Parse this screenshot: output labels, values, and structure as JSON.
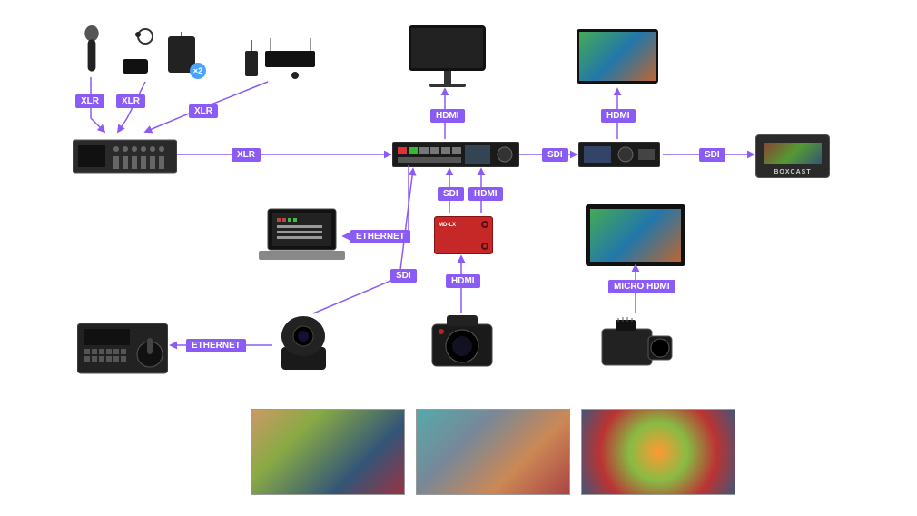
{
  "labels": {
    "xlr1": "XLR",
    "xlr2": "XLR",
    "xlr3": "XLR",
    "xlr4": "XLR",
    "hdmi1": "HDMI",
    "hdmi2": "HDMI",
    "hdmi3": "HDMI",
    "sdi1": "SDI",
    "sdi2": "SDI",
    "sdi3": "SDI",
    "sdi4": "SDI",
    "eth1": "ETHERNET",
    "eth2": "ETHERNET",
    "microhdmi": "MICRO HDMI"
  },
  "badge_x2": "×2",
  "brand_boxcast": "BOXCAST",
  "nodes": {
    "mic": "handheld-microphone",
    "lav": "lavalier-mic-kit",
    "wirelessbox": "wireless-receiver-unit",
    "wireless2": "wireless-receiver-set",
    "mixer": "audio-mixer",
    "switcher": "video-switcher",
    "monitor": "program-monitor",
    "tv": "output-tv",
    "recorder": "hyperdeck-recorder",
    "boxcast": "boxcast-encoder",
    "laptop": "control-laptop",
    "converter": "sdi-hdmi-converter",
    "onair_mon": "on-camera-monitor",
    "ptz": "ptz-camera",
    "ptz_ctrl": "ptz-controller",
    "cinema_cam": "cinema-camera",
    "mirrorless": "mirrorless-camera"
  }
}
